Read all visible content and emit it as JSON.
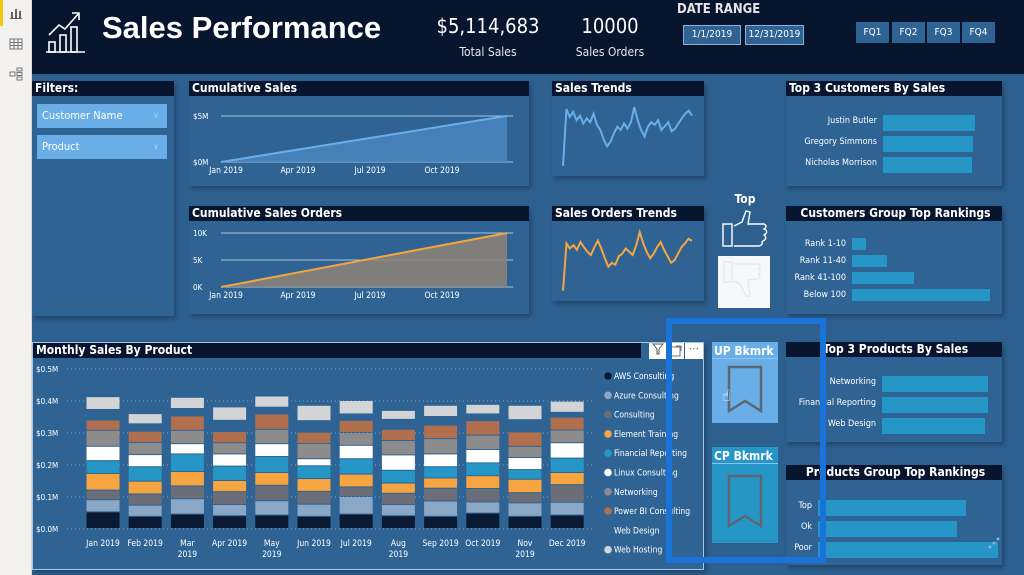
{
  "left_nav": {
    "items": [
      {
        "icon": "report-icon",
        "label": "Report"
      },
      {
        "icon": "table-icon",
        "label": "Data"
      },
      {
        "icon": "model-icon",
        "label": "Model"
      }
    ]
  },
  "header": {
    "title": "Sales Performance",
    "logo_icon": "chart-growth-icon",
    "kpis": [
      {
        "value": "$5,114,683",
        "label": "Total Sales"
      },
      {
        "value": "10000",
        "label": "Sales Orders"
      }
    ],
    "date_range": {
      "label": "DATE RANGE",
      "start": "1/1/2019",
      "end": "12/31/2019"
    },
    "quarter_buttons": [
      "FQ1",
      "FQ2",
      "FQ3",
      "FQ4"
    ]
  },
  "filters": {
    "title": "Filters:",
    "slicers": [
      {
        "label": "Customer Name"
      },
      {
        "label": "Product"
      }
    ]
  },
  "top_toggle": {
    "label": "Top",
    "up_icon": "thumbs-up-icon",
    "down_icon": "thumbs-down-icon"
  },
  "bookmarks": [
    {
      "label": "UP Bkmrk",
      "icon": "bookmark-icon"
    },
    {
      "label": "CP Bkmrk",
      "icon": "bookmark-icon"
    }
  ],
  "chart_data": [
    {
      "id": "cumulative-sales",
      "type": "area",
      "title": "Cumulative Sales",
      "x_ticks": [
        "Jan 2019",
        "Apr 2019",
        "Jul 2019",
        "Oct 2019"
      ],
      "y_ticks": [
        "$0M",
        "$5M"
      ],
      "ylim": [
        0,
        5.1
      ],
      "x": [
        0,
        1
      ],
      "values": [
        0,
        5.11
      ],
      "line_color": "#6aaee8",
      "fill_color": "#4a85c0"
    },
    {
      "id": "cumulative-orders",
      "type": "area",
      "title": "Cumulative Sales Orders",
      "x_ticks": [
        "Jan 2019",
        "Apr 2019",
        "Jul 2019",
        "Oct 2019"
      ],
      "y_ticks": [
        "0K",
        "5K",
        "10K"
      ],
      "ylim": [
        0,
        10000
      ],
      "x": [
        0,
        1
      ],
      "values": [
        0,
        10000
      ],
      "line_color": "#f7a541",
      "fill_color": "#8e8276"
    },
    {
      "id": "sales-trends",
      "type": "line",
      "title": "Sales Trends",
      "values": [
        5,
        92,
        80,
        88,
        75,
        82,
        70,
        78,
        72,
        85,
        68,
        60,
        45,
        35,
        42,
        55,
        65,
        60,
        70,
        62,
        72,
        95,
        75,
        60,
        50,
        65,
        72,
        68,
        75,
        60,
        66,
        72,
        58,
        62,
        70,
        78,
        85,
        90,
        82
      ],
      "ylim": [
        0,
        100
      ],
      "line_color": "#6aaee8"
    },
    {
      "id": "orders-trends",
      "type": "line",
      "title": "Sales Orders Trends",
      "values": [
        5,
        78,
        70,
        75,
        68,
        80,
        72,
        65,
        60,
        72,
        82,
        70,
        55,
        42,
        48,
        45,
        58,
        62,
        70,
        65,
        60,
        75,
        95,
        78,
        65,
        55,
        62,
        72,
        80,
        68,
        58,
        48,
        52,
        62,
        72,
        78,
        85,
        82
      ],
      "ylim": [
        0,
        100
      ],
      "line_color": "#f7a541"
    },
    {
      "id": "top-customers",
      "type": "bar",
      "title": "Top 3 Customers By Sales",
      "categories": [
        "Justin Butler",
        "Gregory Simmons",
        "Nicholas Morrison"
      ],
      "values": [
        100,
        98,
        97
      ]
    },
    {
      "id": "customer-rankings",
      "type": "bar",
      "title": "Customers Group Top Rankings",
      "categories": [
        "Rank 1-10",
        "Rank 11-40",
        "Rank 41-100",
        "Below 100"
      ],
      "values": [
        10,
        25,
        45,
        100
      ]
    },
    {
      "id": "top-products",
      "type": "bar",
      "title": "Top 3 Products By Sales",
      "categories": [
        "Networking",
        "Financial Reporting",
        "Web Design"
      ],
      "values": [
        100,
        100,
        97
      ]
    },
    {
      "id": "product-rankings",
      "type": "bar",
      "title": "Products Group Top Rankings",
      "categories": [
        "Top",
        "Ok",
        "Poor"
      ],
      "values": [
        82,
        77,
        100
      ]
    },
    {
      "id": "monthly-sales",
      "type": "bar",
      "stacked": true,
      "title": "Monthly Sales By Product",
      "categories": [
        "Jan 2019",
        "Feb 2019",
        "Mar 2019",
        "Apr 2019",
        "May 2019",
        "Jun 2019",
        "Jul 2019",
        "Aug 2019",
        "Sep 2019",
        "Oct 2019",
        "Nov 2019",
        "Dec 2019"
      ],
      "y_ticks": [
        "$0.0M",
        "$0.1M",
        "$0.2M",
        "$0.3M",
        "$0.4M",
        "$0.5M"
      ],
      "ylim": [
        0,
        0.5
      ],
      "series": [
        {
          "name": "AWS Consulting",
          "color": "#0a1a33",
          "values": [
            0.052,
            0.038,
            0.045,
            0.04,
            0.042,
            0.038,
            0.045,
            0.04,
            0.038,
            0.048,
            0.038,
            0.042
          ]
        },
        {
          "name": "Azure Consulting",
          "color": "#8aa7c6",
          "values": [
            0.038,
            0.035,
            0.048,
            0.035,
            0.045,
            0.038,
            0.055,
            0.035,
            0.048,
            0.035,
            0.042,
            0.04
          ]
        },
        {
          "name": "Consulting",
          "color": "#6b6e78",
          "values": [
            0.03,
            0.035,
            0.04,
            0.04,
            0.048,
            0.04,
            0.03,
            0.035,
            0.04,
            0.042,
            0.032,
            0.055
          ]
        },
        {
          "name": "Element Training",
          "color": "#f7a541",
          "values": [
            0.052,
            0.04,
            0.045,
            0.035,
            0.04,
            0.04,
            0.04,
            0.032,
            0.032,
            0.04,
            0.042,
            0.038
          ]
        },
        {
          "name": "Financial Reporting",
          "color": "#2596c6",
          "values": [
            0.04,
            0.045,
            0.055,
            0.045,
            0.05,
            0.04,
            0.048,
            0.04,
            0.035,
            0.04,
            0.03,
            0.045
          ]
        },
        {
          "name": "Linux Consulting",
          "color": "#ffffff",
          "values": [
            0.045,
            0.038,
            0.032,
            0.038,
            0.04,
            0.022,
            0.042,
            0.048,
            0.04,
            0.042,
            0.038,
            0.048
          ]
        },
        {
          "name": "Networking",
          "color": "#8c8c8c",
          "values": [
            0.05,
            0.038,
            0.042,
            0.035,
            0.045,
            0.048,
            0.04,
            0.045,
            0.048,
            0.045,
            0.035,
            0.04
          ]
        },
        {
          "name": "Power BI Consulting",
          "color": "#b0704e",
          "values": [
            0.032,
            0.035,
            0.045,
            0.035,
            0.048,
            0.035,
            0.038,
            0.035,
            0.042,
            0.045,
            0.045,
            0.04
          ]
        },
        {
          "name": "Web Design",
          "color": "#2e6394",
          "values": [
            0.033,
            0.023,
            0.023,
            0.035,
            0.021,
            0.036,
            0.02,
            0.031,
            0.027,
            0.021,
            0.038,
            0.015
          ]
        },
        {
          "name": "Web Hosting",
          "color": "#d3d4d6",
          "values": [
            0.04,
            0.032,
            0.035,
            0.042,
            0.035,
            0.048,
            0.042,
            0.028,
            0.035,
            0.03,
            0.045,
            0.035
          ]
        }
      ],
      "legend": "right"
    }
  ]
}
